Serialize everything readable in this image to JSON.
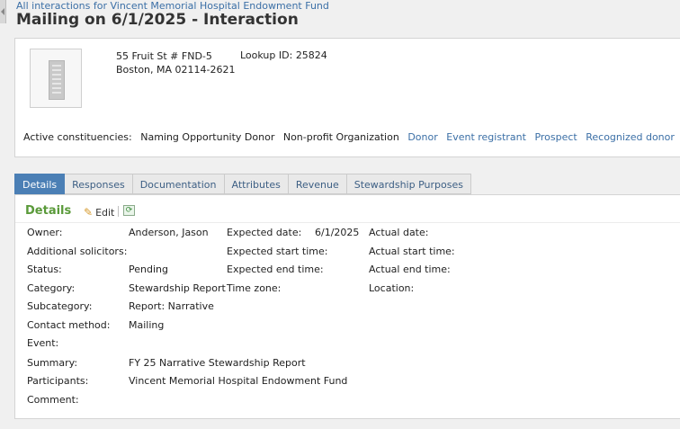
{
  "breadcrumb": {
    "back_link": "All interactions for Vincent Memorial Hospital Endowment Fund"
  },
  "page": {
    "title": "Mailing on 6/1/2025 - Interaction"
  },
  "summary": {
    "address_line1": "55 Fruit St # FND-5",
    "address_line2": "Boston, MA  02114-2621",
    "lookup_label": "Lookup ID:",
    "lookup_value": "25824",
    "constituencies_label": "Active constituencies:",
    "constituencies": [
      {
        "label": "Naming Opportunity Donor",
        "link": false
      },
      {
        "label": "Non-profit Organization",
        "link": false
      },
      {
        "label": "Donor",
        "link": true
      },
      {
        "label": "Event registrant",
        "link": true
      },
      {
        "label": "Prospect",
        "link": true
      },
      {
        "label": "Recognized donor",
        "link": true
      }
    ]
  },
  "tabs": [
    "Details",
    "Responses",
    "Documentation",
    "Attributes",
    "Revenue",
    "Stewardship Purposes"
  ],
  "details": {
    "heading": "Details",
    "edit_label": "Edit",
    "left_labels": [
      "Owner:",
      "Additional solicitors:",
      "Status:",
      "Category:",
      "Subcategory:",
      "Contact method:",
      "Event:",
      "Summary:",
      "Participants:",
      "Comment:"
    ],
    "left_values": [
      "Anderson, Jason",
      "",
      "Pending",
      "Stewardship Report",
      "Report: Narrative",
      "Mailing",
      "",
      "FY 25 Narrative Stewardship Report",
      "Vincent Memorial Hospital Endowment Fund",
      ""
    ],
    "mid_labels": [
      "Expected date:",
      "Expected start time:",
      "Expected end time:",
      "Time zone:"
    ],
    "mid_values": [
      "6/1/2025",
      "",
      "",
      ""
    ],
    "right_labels": [
      "Actual date:",
      "Actual start time:",
      "Actual end time:",
      "Location:"
    ]
  },
  "colors": {
    "link": "#3b6fa6",
    "tab_active": "#4b7fb5",
    "details_heading": "#5a9a3a"
  }
}
